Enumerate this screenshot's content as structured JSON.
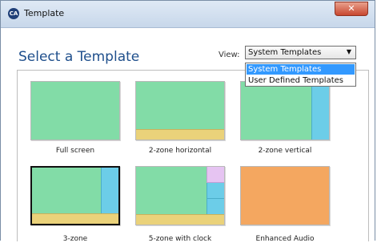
{
  "window": {
    "title": "Template",
    "app_icon_text": "CA",
    "close_glyph": "✕"
  },
  "header": {
    "title": "Select a Template",
    "view_label": "View:"
  },
  "view_select": {
    "value": "System Templates",
    "arrow": "▼",
    "options": [
      "System Templates",
      "User Defined Templates"
    ],
    "highlighted_index": 0
  },
  "templates": [
    {
      "label": "Full screen",
      "selected": false
    },
    {
      "label": "2-zone horizontal",
      "selected": false
    },
    {
      "label": "2-zone vertical",
      "selected": false
    },
    {
      "label": "3-zone",
      "selected": true
    },
    {
      "label": "5-zone with clock",
      "selected": false
    },
    {
      "label": "Enhanced Audio",
      "selected": false
    }
  ],
  "colors": {
    "main_zone": "#82dca7",
    "ticker_zone": "#ead27a",
    "side_zone": "#6ccde8",
    "clock_zone": "#e6c4f2",
    "audio_zone": "#f4a760",
    "heading": "#1f4f8c",
    "dropdown_highlight": "#3399ff"
  }
}
